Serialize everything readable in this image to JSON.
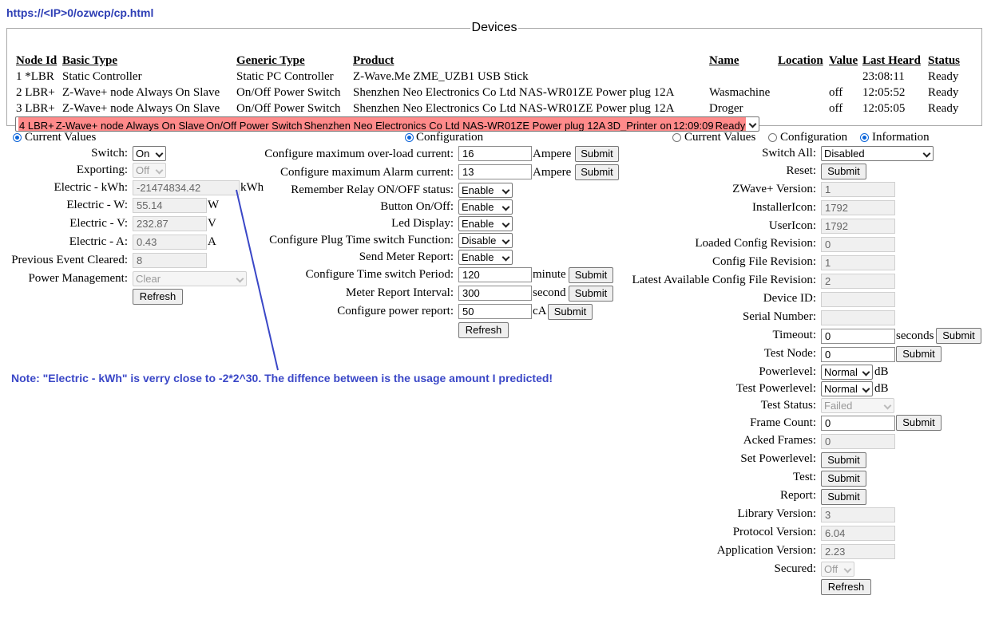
{
  "url": "https://<IP>0/ozwcp/cp.html",
  "devices": {
    "legend": "Devices",
    "headers": [
      "Node Id",
      "Basic Type",
      "Generic Type",
      "Product",
      "Name",
      "Location",
      "Value",
      "Last Heard",
      "Status"
    ],
    "rows": [
      {
        "node": "1 *LBR",
        "basic": "Static Controller",
        "generic": "Static PC Controller",
        "product": "Z-Wave.Me ZME_UZB1 USB Stick",
        "name": "",
        "location": "",
        "value": "",
        "heard": "23:08:11",
        "status": "Ready"
      },
      {
        "node": "2 LBR+",
        "basic": "Z-Wave+ node Always On Slave",
        "generic": "On/Off Power Switch",
        "product": "Shenzhen Neo Electronics Co Ltd NAS-WR01ZE Power plug 12A",
        "name": "Wasmachine",
        "location": "",
        "value": "off",
        "heard": "12:05:52",
        "status": "Ready"
      },
      {
        "node": "3 LBR+",
        "basic": "Z-Wave+ node Always On Slave",
        "generic": "On/Off Power Switch",
        "product": "Shenzhen Neo Electronics Co Ltd NAS-WR01ZE Power plug 12A",
        "name": "Droger",
        "location": "",
        "value": "off",
        "heard": "12:05:05",
        "status": "Ready"
      },
      {
        "node": "4 LBR+",
        "basic": "Z-Wave+ node Always On Slave",
        "generic": "On/Off Power Switch",
        "product": "Shenzhen Neo Electronics Co Ltd NAS-WR01ZE Power plug 12A",
        "name": "3D_Printer",
        "location": "",
        "value": "on",
        "heard": "12:09:09",
        "status": "Ready"
      }
    ],
    "selected_color": "#ff8a8a"
  },
  "left": {
    "radio_label": "Current Values",
    "switch": {
      "label": "Switch:",
      "value": "On"
    },
    "exporting": {
      "label": "Exporting:",
      "value": "Off"
    },
    "kwh": {
      "label": "Electric - kWh:",
      "value": "-21474834.42",
      "unit": "kWh"
    },
    "w": {
      "label": "Electric - W:",
      "value": "55.14",
      "unit": "W"
    },
    "v": {
      "label": "Electric - V:",
      "value": "232.87",
      "unit": "V"
    },
    "a": {
      "label": "Electric - A:",
      "value": "0.43",
      "unit": "A"
    },
    "prev": {
      "label": "Previous Event Cleared:",
      "value": "8"
    },
    "power": {
      "label": "Power Management:",
      "value": "Clear"
    },
    "refresh": "Refresh"
  },
  "middle": {
    "radio_label": "Configuration",
    "overload": {
      "label": "Configure maximum over-load current:",
      "value": "16",
      "unit": "Ampere",
      "button": "Submit"
    },
    "alarm": {
      "label": "Configure maximum Alarm current:",
      "value": "13",
      "unit": "Ampere",
      "button": "Submit"
    },
    "relay": {
      "label": "Remember Relay ON/OFF status:",
      "value": "Enable"
    },
    "button_onoff": {
      "label": "Button On/Off:",
      "value": "Enable"
    },
    "led": {
      "label": "Led Display:",
      "value": "Enable"
    },
    "plugtime": {
      "label": "Configure Plug Time switch Function:",
      "value": "Disable"
    },
    "meter": {
      "label": "Send Meter Report:",
      "value": "Enable"
    },
    "period": {
      "label": "Configure Time switch Period:",
      "value": "120",
      "unit": "minute",
      "button": "Submit"
    },
    "interval": {
      "label": "Meter Report Interval:",
      "value": "300",
      "unit": "second",
      "button": "Submit"
    },
    "powerrep": {
      "label": "Configure power report:",
      "value": "50",
      "unit": "cA",
      "button": "Submit"
    },
    "refresh": "Refresh"
  },
  "right": {
    "radios": [
      "Current Values",
      "Configuration",
      "Information"
    ],
    "switchall": {
      "label": "Switch All:",
      "value": "Disabled"
    },
    "reset": {
      "label": "Reset:",
      "button": "Submit"
    },
    "zwave": {
      "label": "ZWave+ Version:",
      "value": "1"
    },
    "installer": {
      "label": "InstallerIcon:",
      "value": "1792"
    },
    "usericon": {
      "label": "UserIcon:",
      "value": "1792"
    },
    "loaded": {
      "label": "Loaded Config Revision:",
      "value": "0"
    },
    "configfile": {
      "label": "Config File Revision:",
      "value": "1"
    },
    "latest": {
      "label": "Latest Available Config File Revision:",
      "value": "2"
    },
    "deviceid": {
      "label": "Device ID:",
      "value": ""
    },
    "serial": {
      "label": "Serial Number:",
      "value": ""
    },
    "timeout": {
      "label": "Timeout:",
      "value": "0",
      "unit": "seconds",
      "button": "Submit"
    },
    "testnode": {
      "label": "Test Node:",
      "value": "0",
      "button": "Submit"
    },
    "powerlevel": {
      "label": "Powerlevel:",
      "value": "Normal",
      "unit": "dB"
    },
    "testpower": {
      "label": "Test Powerlevel:",
      "value": "Normal",
      "unit": "dB"
    },
    "teststatus": {
      "label": "Test Status:",
      "value": "Failed"
    },
    "frame": {
      "label": "Frame Count:",
      "value": "0",
      "button": "Submit"
    },
    "acked": {
      "label": "Acked Frames:",
      "value": "0"
    },
    "setpower": {
      "label": "Set Powerlevel:",
      "button": "Submit"
    },
    "test": {
      "label": "Test:",
      "button": "Submit"
    },
    "report": {
      "label": "Report:",
      "button": "Submit"
    },
    "library": {
      "label": "Library Version:",
      "value": "3"
    },
    "protocol": {
      "label": "Protocol Version:",
      "value": "6.04"
    },
    "application": {
      "label": "Application Version:",
      "value": "2.23"
    },
    "secured": {
      "label": "Secured:",
      "value": "Off"
    },
    "refresh": "Refresh"
  },
  "note": "Note: \"Electric - kWh\" is verry close to -2*2^30. The diffence between is the usage amount I predicted!",
  "note_color": "#3a47c7"
}
